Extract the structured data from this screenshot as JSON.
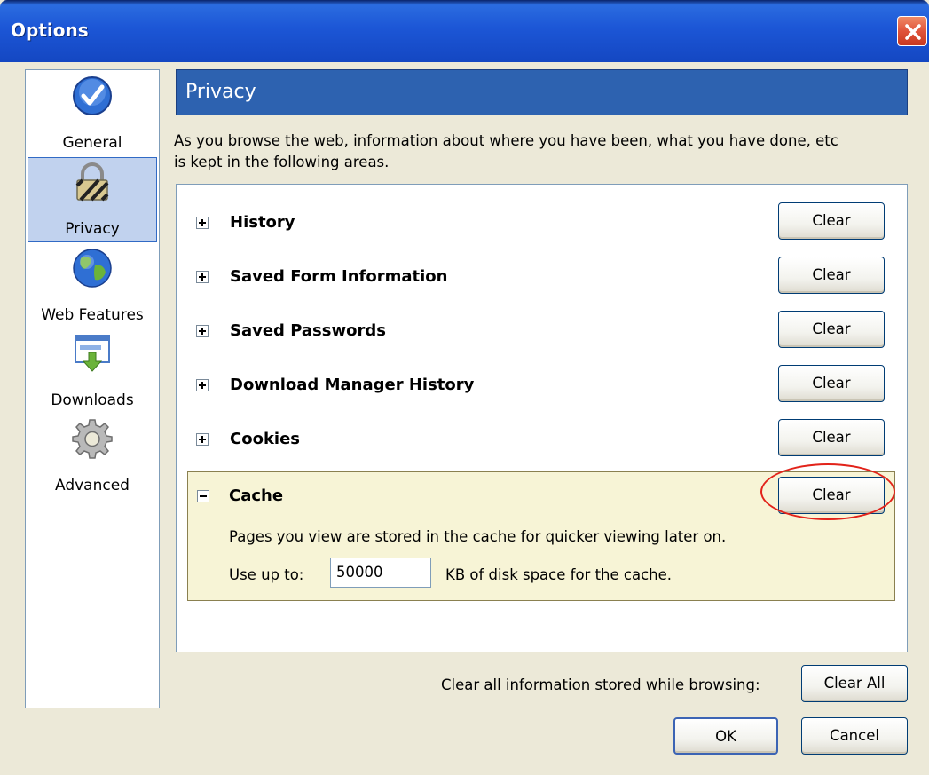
{
  "window": {
    "title": "Options"
  },
  "nav": {
    "items": [
      {
        "label": "General",
        "icon": "checkmark-icon",
        "selected": false
      },
      {
        "label": "Privacy",
        "icon": "padlock-icon",
        "selected": true
      },
      {
        "label": "Web Features",
        "icon": "globe-icon",
        "selected": false
      },
      {
        "label": "Downloads",
        "icon": "download-window-icon",
        "selected": false
      },
      {
        "label": "Advanced",
        "icon": "gear-icon",
        "selected": false
      }
    ]
  },
  "section": {
    "title": "Privacy",
    "description_line1": "As you browse the web, information about where you have been, what you have done, etc",
    "description_line2": "is kept in the following areas."
  },
  "items": [
    {
      "label": "History",
      "button": "Clear",
      "expanded": false
    },
    {
      "label": "Saved Form Information",
      "button": "Clear",
      "expanded": false
    },
    {
      "label": "Saved Passwords",
      "button": "Clear",
      "expanded": false
    },
    {
      "label": "Download Manager History",
      "button": "Clear",
      "expanded": false
    },
    {
      "label": "Cookies",
      "button": "Clear",
      "expanded": false
    }
  ],
  "cache": {
    "label": "Cache",
    "button": "Clear",
    "expanded": true,
    "description": "Pages you view are stored in the cache for quicker viewing later on.",
    "use_up_to_underlined": "U",
    "use_up_to_rest": "se up to:",
    "size_value": "50000",
    "size_suffix": "KB of disk space for the cache."
  },
  "footer": {
    "clear_all_text": "Clear all information stored while browsing:",
    "clear_all_button": "Clear All",
    "ok_button": "OK",
    "cancel_button": "Cancel"
  },
  "colors": {
    "titlebar": "#1c56d6",
    "header_band": "#2d62b0",
    "cache_background": "#f7f4d6",
    "highlight_ring": "#e2231a"
  }
}
